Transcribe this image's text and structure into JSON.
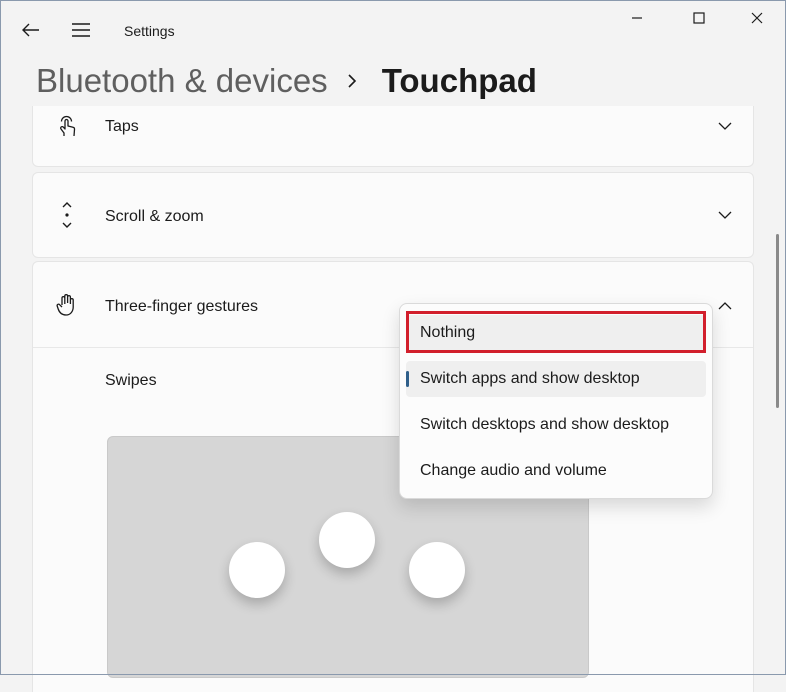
{
  "window": {
    "app_title": "Settings"
  },
  "breadcrumb": {
    "parent": "Bluetooth & devices",
    "current": "Touchpad"
  },
  "sections": {
    "taps": {
      "label": "Taps"
    },
    "scroll_zoom": {
      "label": "Scroll & zoom"
    },
    "three_finger": {
      "label": "Three-finger gestures",
      "swipes_label": "Swipes"
    }
  },
  "dropdown": {
    "options": [
      {
        "label": "Nothing"
      },
      {
        "label": "Switch apps and show desktop",
        "selected": true
      },
      {
        "label": "Switch desktops and show desktop"
      },
      {
        "label": "Change audio and volume"
      }
    ],
    "highlight_color": "#d21f2c"
  },
  "icons": {
    "back": "back-arrow-icon",
    "menu": "hamburger-menu-icon",
    "minimize": "minimize-icon",
    "maximize": "maximize-icon",
    "close": "close-icon",
    "taps": "tap-hand-icon",
    "scroll": "scroll-arrows-icon",
    "three_finger": "three-finger-hand-icon"
  },
  "colors": {
    "background": "#f3f3f3",
    "card": "#fbfbfb",
    "accent": "#2f5f8a"
  }
}
